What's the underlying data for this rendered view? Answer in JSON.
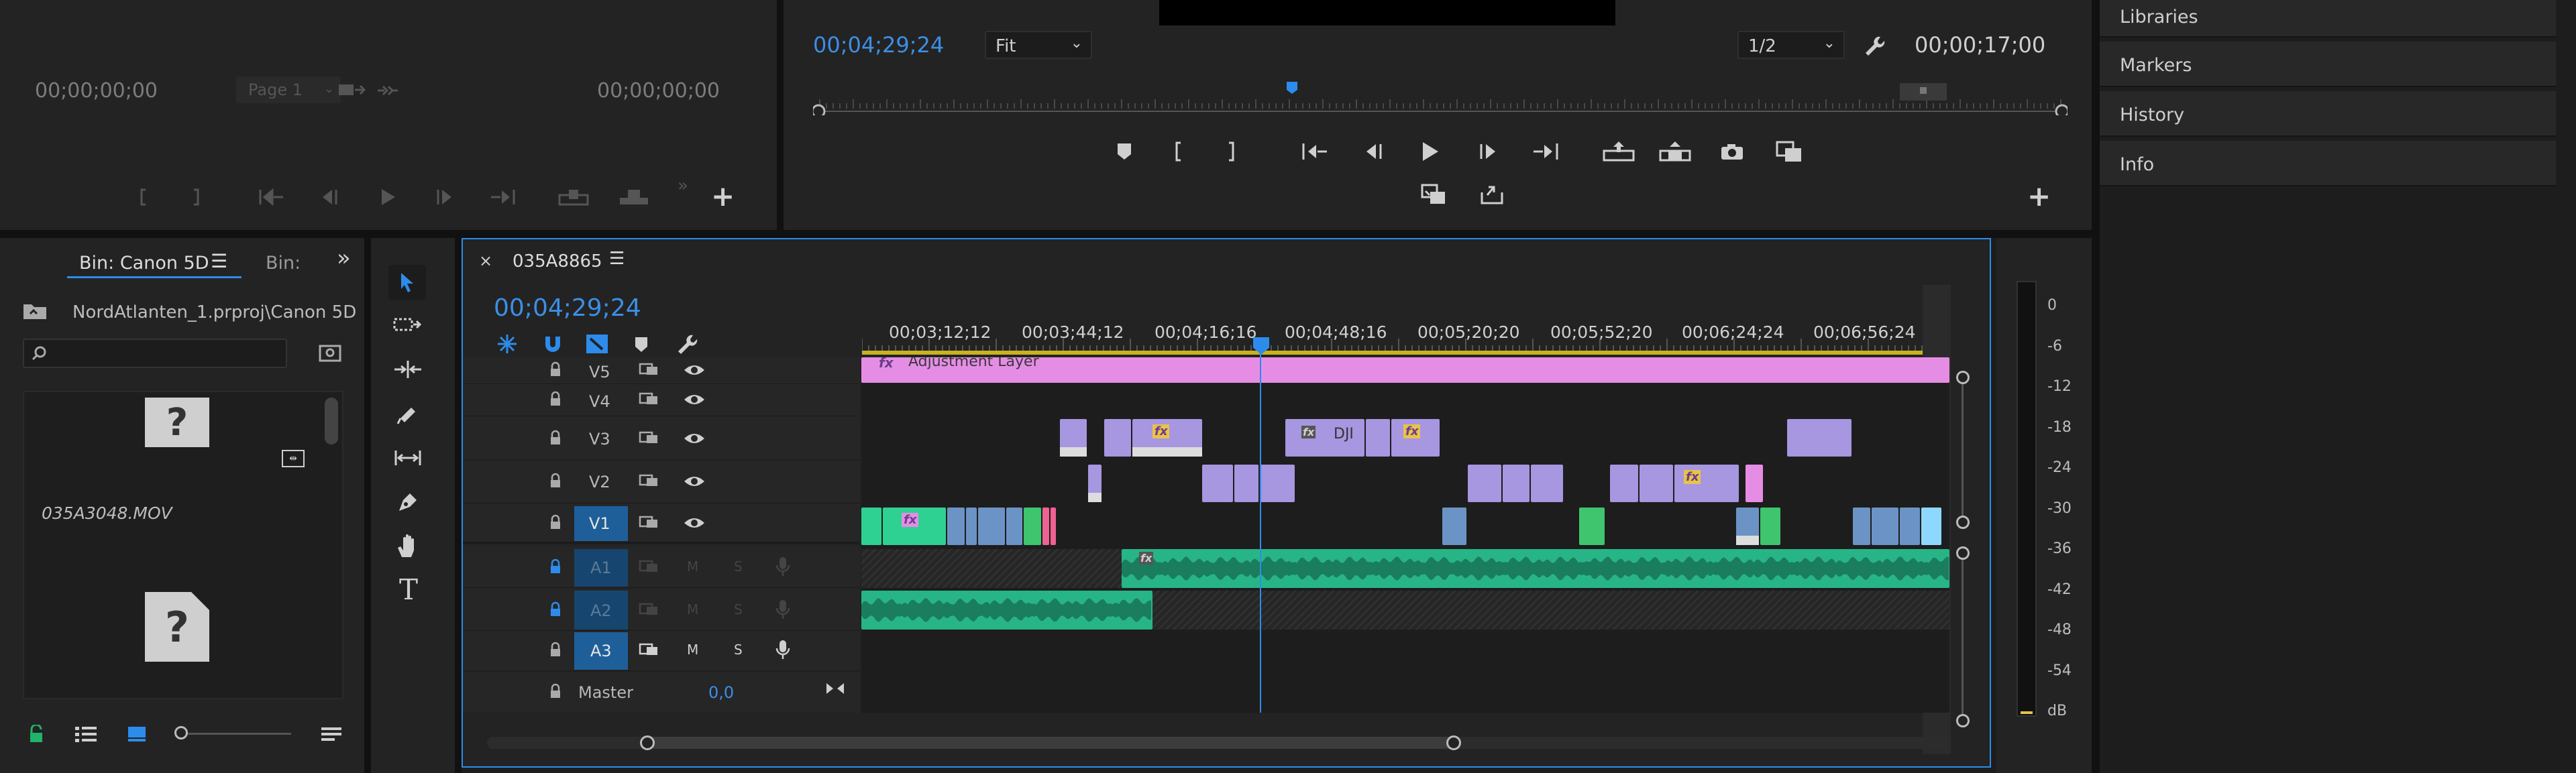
{
  "source_monitor": {
    "timecode_in": "00;00;00;00",
    "page_select": "Page 1",
    "timecode_out": "00;00;00;00"
  },
  "program_monitor": {
    "timecode": "00;04;29;24",
    "fit_select": "Fit",
    "resolution_select": "1/2",
    "duration": "00;00;17;00"
  },
  "right_panel": {
    "items": [
      "Libraries",
      "Markers",
      "History",
      "Info"
    ]
  },
  "project_panel": {
    "tab_active": "Bin: Canon 5D",
    "tab_second": "Bin:",
    "path": "NordAtlanten_1.prproj\\Canon 5D",
    "items": [
      {
        "name": "035A3048.MOV"
      }
    ]
  },
  "timeline": {
    "sequence_name": "035A8865",
    "timecode": "00;04;29;24",
    "ruler_ticks": [
      "00;03;12;12",
      "00;03;44;12",
      "00;04;16;16",
      "00;04;48;16",
      "00;05;20;20",
      "00;05;52;20",
      "00;06;24;24",
      "00;06;56;24"
    ],
    "video_tracks": [
      "V5",
      "V4",
      "V3",
      "V2",
      "V1"
    ],
    "audio_tracks": [
      "A1",
      "A2",
      "A3"
    ],
    "master_label": "Master",
    "master_value": "0,0",
    "m_label": "M",
    "s_label": "S",
    "adjustment_layer_label": "Adjustment Layer",
    "clip_label_dji": "DJI",
    "fx_label": "fx"
  },
  "audio_meter": {
    "scale": [
      "0",
      "-6",
      "-12",
      "-18",
      "-24",
      "-30",
      "-36",
      "-42",
      "-48",
      "-54",
      "dB"
    ]
  },
  "colors": {
    "accent": "#2d8ceb",
    "adjustment": "#e58de5",
    "video_clip": "#a796e0",
    "video_green": "#2fd192",
    "audio": "#27b587"
  }
}
